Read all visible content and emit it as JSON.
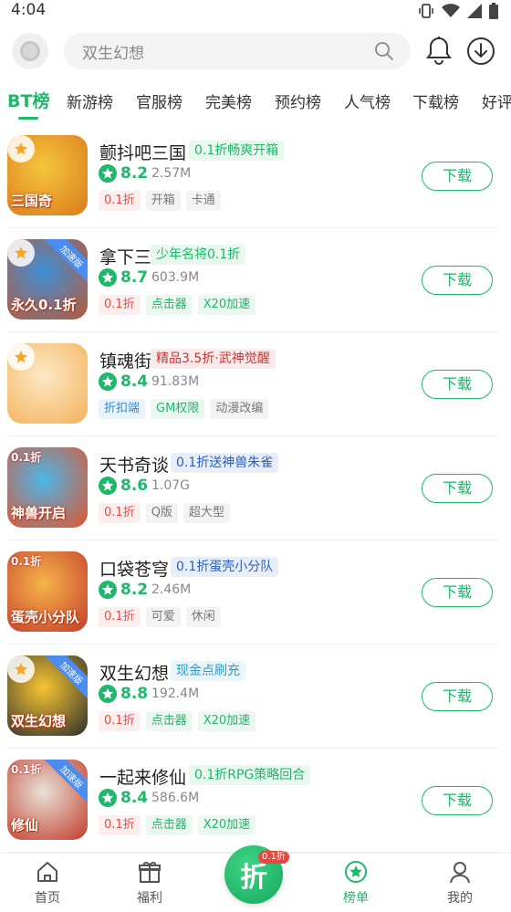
{
  "status_bar": {
    "time": "4:04",
    "icons": [
      "vibrate-icon",
      "wifi-icon",
      "signal-icon",
      "battery-icon"
    ]
  },
  "header": {
    "search_placeholder": "双生幻想",
    "icons": [
      "app-logo-icon",
      "search-icon",
      "bell-icon",
      "download-icon"
    ]
  },
  "tabs": [
    {
      "label": "BT榜",
      "active": true
    },
    {
      "label": "新游榜"
    },
    {
      "label": "官服榜"
    },
    {
      "label": "完美榜"
    },
    {
      "label": "预约榜"
    },
    {
      "label": "人气榜"
    },
    {
      "label": "下载榜"
    },
    {
      "label": "好评"
    }
  ],
  "games": [
    {
      "name": "颤抖吧三国",
      "promo": "0.1折畅爽开箱",
      "promo_color": "green",
      "rating": "8.2",
      "size": "2.57M",
      "tags": [
        {
          "label": "0.1折",
          "color": "red"
        },
        {
          "label": "开箱",
          "color": "gray"
        },
        {
          "label": "卡通",
          "color": "gray"
        }
      ],
      "button": "下载",
      "icon_caption": "三国奇",
      "icon_colors": [
        "#f6c63c",
        "#d97a1c"
      ]
    },
    {
      "name": "拿下三国",
      "promo": "少年名将0.1折",
      "promo_color": "green",
      "rating": "8.7",
      "size": "603.9M",
      "tags": [
        {
          "label": "0.1折",
          "color": "red"
        },
        {
          "label": "点击器",
          "color": "green"
        },
        {
          "label": "X20加速",
          "color": "green"
        }
      ],
      "button": "下载",
      "icon_caption": "永久0.1折",
      "ribbon": "加速版",
      "icon_colors": [
        "#3f8fd6",
        "#b85a3a"
      ]
    },
    {
      "name": "镇魂街",
      "promo": "精品3.5折·武神觉醒",
      "promo_color": "red",
      "rating": "8.4",
      "size": "91.83M",
      "tags": [
        {
          "label": "折扣端",
          "color": "blue"
        },
        {
          "label": "GM权限",
          "color": "green"
        },
        {
          "label": "动漫改编",
          "color": "gray"
        }
      ],
      "button": "下载",
      "icon_colors": [
        "#fde9c6",
        "#f3b15a"
      ]
    },
    {
      "name": "天书奇谈",
      "promo": "0.1折送神兽朱雀",
      "promo_color": "blue",
      "rating": "8.6",
      "size": "1.07G",
      "tags": [
        {
          "label": "0.1折",
          "color": "red"
        },
        {
          "label": "Q版",
          "color": "gray"
        },
        {
          "label": "超大型",
          "color": "gray"
        }
      ],
      "button": "下载",
      "icon_caption": "神兽开启",
      "discount": "0.1折",
      "icon_colors": [
        "#4bb6e8",
        "#e2542c"
      ]
    },
    {
      "name": "口袋苍穹",
      "promo": "0.1折蛋壳小分队",
      "promo_color": "blue",
      "rating": "8.2",
      "size": "2.46M",
      "tags": [
        {
          "label": "0.1折",
          "color": "red"
        },
        {
          "label": "可爱",
          "color": "gray"
        },
        {
          "label": "休闲",
          "color": "gray"
        }
      ],
      "button": "下载",
      "icon_caption": "蛋壳小分队",
      "discount": "0.1折",
      "icon_colors": [
        "#f6b44a",
        "#c43d2b"
      ]
    },
    {
      "name": "双生幻想",
      "promo": "现金点刷充",
      "promo_color": "cyan",
      "rating": "8.8",
      "size": "192.4M",
      "tags": [
        {
          "label": "0.1折",
          "color": "red"
        },
        {
          "label": "点击器",
          "color": "green"
        },
        {
          "label": "X20加速",
          "color": "green"
        }
      ],
      "button": "下载",
      "icon_caption": "双生幻想",
      "ribbon": "加速版",
      "icon_colors": [
        "#f7c530",
        "#2e2e2e"
      ]
    },
    {
      "name": "一起来修仙",
      "promo": "0.1折RPG策略回合",
      "promo_color": "green",
      "rating": "8.4",
      "size": "586.6M",
      "tags": [
        {
          "label": "0.1折",
          "color": "red"
        },
        {
          "label": "点击器",
          "color": "green"
        },
        {
          "label": "X20加速",
          "color": "green"
        }
      ],
      "button": "下载",
      "icon_caption": "修仙",
      "ribbon": "加速版",
      "discount": "0.1折",
      "icon_colors": [
        "#e7e2d6",
        "#c33b2b"
      ]
    }
  ],
  "bottom_nav": [
    {
      "label": "首页",
      "icon": "home-icon"
    },
    {
      "label": "福利",
      "icon": "gift-icon"
    },
    {
      "label": "折",
      "icon": "discount-center-icon",
      "badge": "0.1折"
    },
    {
      "label": "榜单",
      "icon": "ranking-star-icon",
      "active": true
    },
    {
      "label": "我的",
      "icon": "profile-icon"
    }
  ],
  "colors": {
    "accent": "#1db86a",
    "discount_red": "#e0504a"
  }
}
